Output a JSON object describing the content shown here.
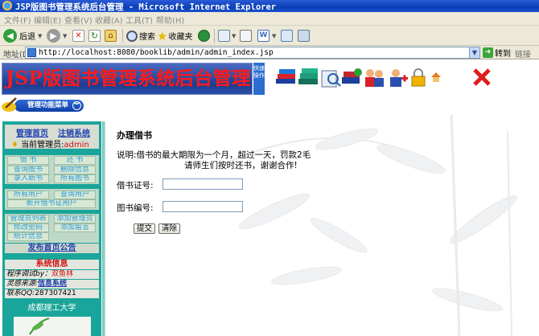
{
  "window": {
    "title": "JSP版图书管理系统后台管理 - Microsoft Internet Explorer"
  },
  "menu": {
    "items": [
      "文件(F)",
      "编辑(E)",
      "查看(V)",
      "收藏(A)",
      "工具(T)",
      "帮助(H)"
    ]
  },
  "toolbar": {
    "back": "后退",
    "search": "搜索",
    "favorites": "收藏夹"
  },
  "address": {
    "label": "地址(D)",
    "url": "http://localhost:8080/booklib/admin/admin_index.jsp",
    "go": "转到",
    "links": "链接"
  },
  "banner": {
    "title": "JSP版图书管理系统后台管理",
    "side_text": "快速操作"
  },
  "function_menu": {
    "label": "管理功能菜单"
  },
  "sidebar": {
    "home_link": "管理首页",
    "logout_link": "注销系统",
    "admin_label": "当前管理员:",
    "admin_name": "admin",
    "group1": [
      "借 书",
      "还 书",
      "查询图书",
      "删除信息",
      "录入新书",
      "所有图书"
    ],
    "group2": [
      "所有用户",
      "查询用户",
      "新开借书证用户"
    ],
    "group3": [
      "管理员列表",
      "添加管理员",
      "修改密码",
      "添加留言",
      "统计信息"
    ],
    "publish": "发布首页公告",
    "sys_title": "系统信息",
    "sys_rows": [
      {
        "label": "程序调试by：",
        "value": "双鱼林"
      },
      {
        "label": "灵感来源:",
        "value": "信息系统"
      },
      {
        "label": "联系QQ:",
        "value": "287307421"
      }
    ],
    "school": "成都理工大学"
  },
  "main": {
    "title": "办理借书",
    "desc_line1": "说明:借书的最大期限为一个月，超过一天，罚款2毛",
    "desc_line2": "请师生们按时还书，谢谢合作!",
    "card_label": "借书证号:",
    "card_value": "",
    "book_label": "图书编号:",
    "book_value": "",
    "submit": "提交",
    "reset": "清除"
  }
}
